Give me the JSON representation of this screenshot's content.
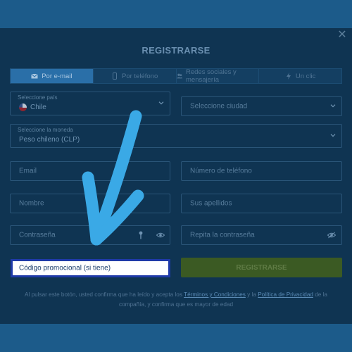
{
  "modal": {
    "title": "REGISTRARSE",
    "close_icon": "close-icon"
  },
  "tabs": [
    {
      "label": "Por e-mail",
      "icon": "envelope-icon",
      "active": true
    },
    {
      "label": "Por teléfono",
      "icon": "phone-icon",
      "active": false
    },
    {
      "label": "Redes sociales y mensajería",
      "icon": "users-icon",
      "active": false
    },
    {
      "label": "Un clic",
      "icon": "lightning-icon",
      "active": false
    }
  ],
  "form": {
    "country_label": "Seleccione país",
    "country_value": "Chile",
    "city_placeholder": "Seleccione ciudad",
    "currency_label": "Seleccione la moneda",
    "currency_value": "Peso chileno (CLP)",
    "email_placeholder": "Email",
    "phone_placeholder": "Número de teléfono",
    "name_placeholder": "Nombre",
    "surname_placeholder": "Sus apellidos",
    "password_placeholder": "Contraseña",
    "repeat_password_placeholder": "Repita la contraseña",
    "promo_placeholder": "Código promocional (si tiene)",
    "register_button": "REGISTRARSE"
  },
  "legal": {
    "text_1": "Al pulsar este botón, usted confirma que ha leído y acepta los ",
    "terms_link": "Términos y Condiciones",
    "text_2": " y la ",
    "privacy_link": "Política de Privacidad",
    "text_3": " de la compañía, y confirma que es mayor de edad"
  },
  "colors": {
    "accent_arrow": "#3aa9e6",
    "promo_border": "#1f3aa8",
    "register_button_bg": "#3b5a23",
    "active_tab_bg": "#2a6fa8"
  }
}
